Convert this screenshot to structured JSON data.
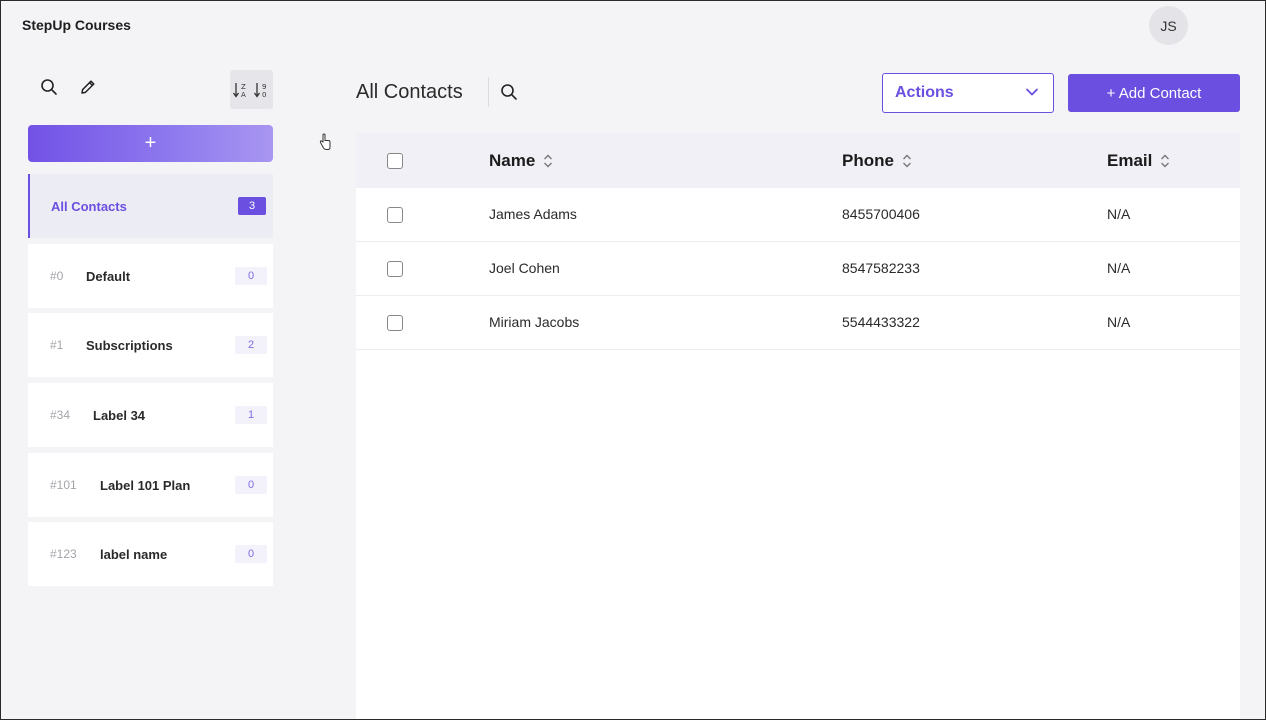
{
  "app": {
    "title": "StepUp Courses",
    "user_initials": "JS"
  },
  "sidebar": {
    "add_button_label": "+",
    "labels": [
      {
        "id": "",
        "name": "All Contacts",
        "count": "3",
        "active": true
      },
      {
        "id": "#0",
        "name": "Default",
        "count": "0"
      },
      {
        "id": "#1",
        "name": "Subscriptions",
        "count": "2"
      },
      {
        "id": "#34",
        "name": "Label 34",
        "count": "1"
      },
      {
        "id": "#101",
        "name": "Label 101 Plan",
        "count": "0"
      },
      {
        "id": "#123",
        "name": "label name",
        "count": "0"
      }
    ],
    "icons": [
      "search-icon",
      "edit-icon",
      "sort-alpha-icon",
      "sort-numeric-icon"
    ]
  },
  "main": {
    "title": "All Contacts",
    "actions_select": {
      "value": "Actions"
    },
    "add_contact_label": "+ Add Contact",
    "table": {
      "columns": [
        "Name",
        "Phone",
        "Email"
      ],
      "rows": [
        {
          "name": "James Adams",
          "phone": "8455700406",
          "email": "N/A"
        },
        {
          "name": "Joel Cohen",
          "phone": "8547582233",
          "email": "N/A"
        },
        {
          "name": "Miriam Jacobs",
          "phone": "5544433322",
          "email": "N/A"
        }
      ]
    }
  },
  "colors": {
    "accent": "#6a4fe0",
    "background": "#f4f4f6",
    "header_row": "#f0f0f6"
  }
}
